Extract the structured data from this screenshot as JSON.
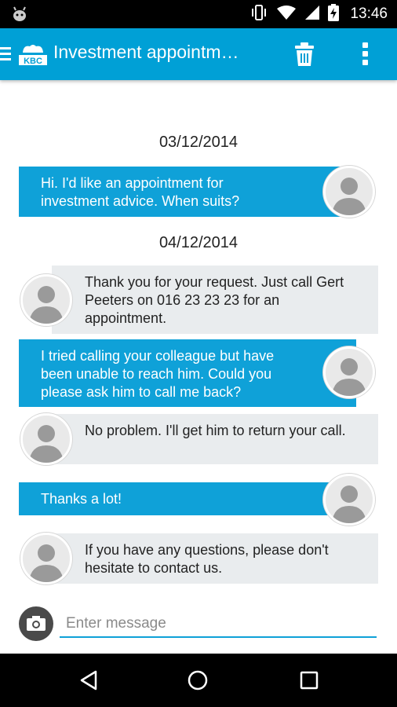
{
  "status_bar": {
    "time": "13:46"
  },
  "app_bar": {
    "title": "Investment appointm…",
    "brand": "KBC"
  },
  "conversation": {
    "dates": [
      "03/12/2014",
      "04/12/2014"
    ],
    "messages": [
      {
        "direction": "out",
        "text": "Hi. I'd like an appointment for investment advice. When suits?"
      },
      {
        "direction": "in",
        "text": "Thank you for your request. Just call Gert Peeters on 016 23 23 23 for an appointment."
      },
      {
        "direction": "out",
        "text": "I tried calling your colleague but have been unable to reach him. Could you please ask him to call me back?"
      },
      {
        "direction": "in",
        "text": "No problem. I'll get him to return your call."
      },
      {
        "direction": "out",
        "text": "Thanks a lot!"
      },
      {
        "direction": "in",
        "text": "If you have any questions, please don't hesitate to contact us."
      }
    ]
  },
  "composer": {
    "placeholder": "Enter message",
    "value": ""
  },
  "colors": {
    "accent": "#00a0d6",
    "outgoing_bubble": "#0fa1d8",
    "incoming_bubble": "#e9ecee"
  }
}
